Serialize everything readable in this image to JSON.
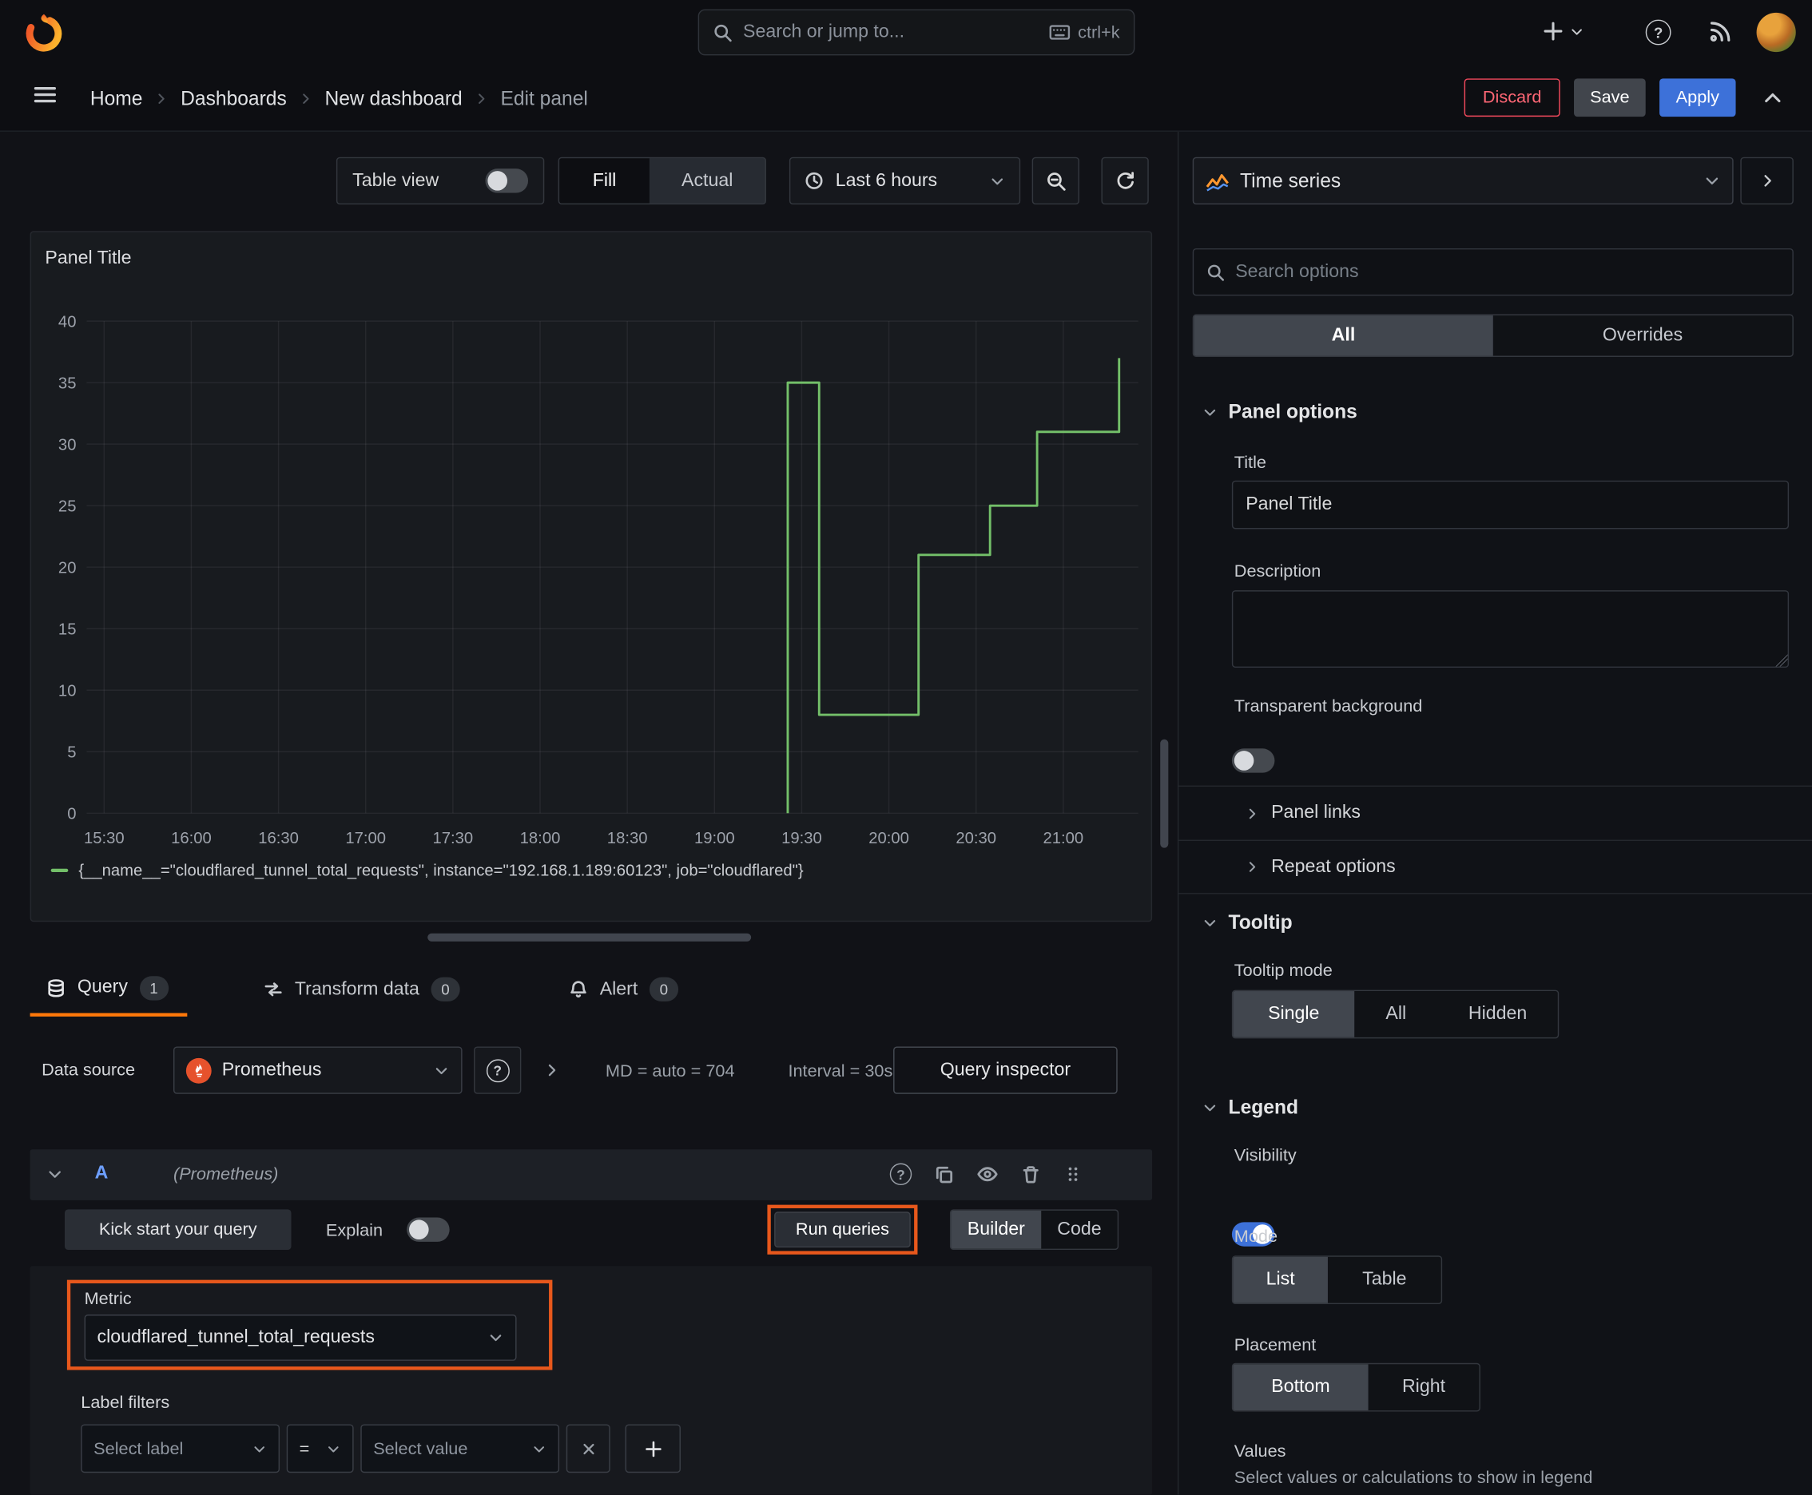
{
  "colors": {
    "grafana_orange": "#ff780a",
    "annotation_highlight": "#e8581c",
    "series_green": "#73bf69",
    "apply_blue": "#3d71d9",
    "discard_red": "#f2495c",
    "ref_id_blue": "#6e9fff",
    "toggle_on_blue": "#3d71d9",
    "prometheus_orange": "#e6522c"
  },
  "icons": {
    "grafana-logo": "orange flame swirl",
    "search": "magnifier",
    "keyboard": "keyboard",
    "new": "plus with caret",
    "help": "question circle",
    "news": "rss",
    "profile": "avatar circle",
    "menu": "hamburger",
    "time-range": "clock",
    "zoom-out": "magnifier minus",
    "refresh": "circular arrow",
    "visualization": "mini line chart",
    "query": "database",
    "transform": "swap arrows",
    "alert": "bell",
    "datasource": "prometheus torch",
    "duplicate": "copy",
    "hide": "eye",
    "delete": "trash",
    "drag": "grip dots",
    "remove-filter": "x",
    "add-filter": "plus",
    "collapse": "chevron-up"
  },
  "topnav": {
    "search_placeholder": "Search or jump to...",
    "shortcut_hint": "ctrl+k"
  },
  "breadcrumb": {
    "items": [
      "Home",
      "Dashboards",
      "New dashboard",
      "Edit panel"
    ]
  },
  "actions": {
    "discard": "Discard",
    "save": "Save",
    "apply": "Apply"
  },
  "toolbar": {
    "table_view_label": "Table view",
    "display_mode": {
      "fill": "Fill",
      "actual": "Actual",
      "selected": "Fill"
    },
    "time_range": "Last 6 hours"
  },
  "panel": {
    "title": "Panel Title"
  },
  "chart_data": {
    "type": "line",
    "line_style": "step-after",
    "title": "Panel Title",
    "xlabel": "",
    "ylabel": "",
    "grid": true,
    "legend_position": "bottom",
    "x_ticks": [
      "15:30",
      "16:00",
      "16:30",
      "17:00",
      "17:30",
      "18:00",
      "18:30",
      "19:00",
      "19:30",
      "20:00",
      "20:30",
      "21:00"
    ],
    "x_tick_hours": [
      15.5,
      16,
      16.5,
      17,
      17.5,
      18,
      18.5,
      19,
      19.5,
      20,
      20.5,
      21
    ],
    "x_range": [
      15.4,
      21.43
    ],
    "y_range": [
      0,
      40
    ],
    "y_ticks": [
      0,
      5,
      10,
      15,
      20,
      25,
      30,
      35,
      40
    ],
    "series": [
      {
        "name": "{__name__=\"cloudflared_tunnel_total_requests\", instance=\"192.168.1.189:60123\", job=\"cloudflared\"}",
        "color": "#73bf69",
        "points": [
          [
            19.42,
            0
          ],
          [
            19.42,
            35
          ],
          [
            19.6,
            35
          ],
          [
            19.6,
            8
          ],
          [
            20.17,
            8
          ],
          [
            20.17,
            21
          ],
          [
            20.58,
            21
          ],
          [
            20.58,
            25
          ],
          [
            20.85,
            25
          ],
          [
            20.85,
            31
          ],
          [
            21.32,
            31
          ],
          [
            21.32,
            37
          ]
        ]
      }
    ]
  },
  "tabs": {
    "query": {
      "label": "Query",
      "count": "1"
    },
    "transform": {
      "label": "Transform data",
      "count": "0"
    },
    "alert": {
      "label": "Alert",
      "count": "0"
    }
  },
  "query": {
    "datasource_label": "Data source",
    "datasource_value": "Prometheus",
    "max_data_points": "MD = auto = 704",
    "interval": "Interval = 30s",
    "inspector_button": "Query inspector",
    "ref_id": "A",
    "ref_datasource": "(Prometheus)",
    "kick_start_button": "Kick start your query",
    "explain_label": "Explain",
    "run_queries_button": "Run queries",
    "editor_mode": {
      "builder": "Builder",
      "code": "Code",
      "selected": "Builder"
    },
    "metric_label": "Metric",
    "metric_value": "cloudflared_tunnel_total_requests",
    "label_filters_label": "Label filters",
    "select_label_placeholder": "Select label",
    "operator_value": "=",
    "select_value_placeholder": "Select value"
  },
  "sidebar": {
    "visualization": "Time series",
    "search_placeholder": "Search options",
    "tabs": {
      "all": "All",
      "overrides": "Overrides",
      "selected": "All"
    },
    "panel_options": {
      "heading": "Panel options",
      "title_label": "Title",
      "title_value": "Panel Title",
      "description_label": "Description",
      "description_value": "",
      "transparent_label": "Transparent background",
      "transparent_value": false,
      "panel_links": "Panel links",
      "repeat_options": "Repeat options"
    },
    "tooltip": {
      "heading": "Tooltip",
      "mode_label": "Tooltip mode",
      "options": [
        "Single",
        "All",
        "Hidden"
      ],
      "selected": "Single"
    },
    "legend": {
      "heading": "Legend",
      "visibility_label": "Visibility",
      "visibility_value": true,
      "mode_label": "Mode",
      "mode_options": [
        "List",
        "Table"
      ],
      "mode_selected": "List",
      "placement_label": "Placement",
      "placement_options": [
        "Bottom",
        "Right"
      ],
      "placement_selected": "Bottom",
      "values_label": "Values",
      "values_help": "Select values or calculations to show in legend"
    }
  }
}
